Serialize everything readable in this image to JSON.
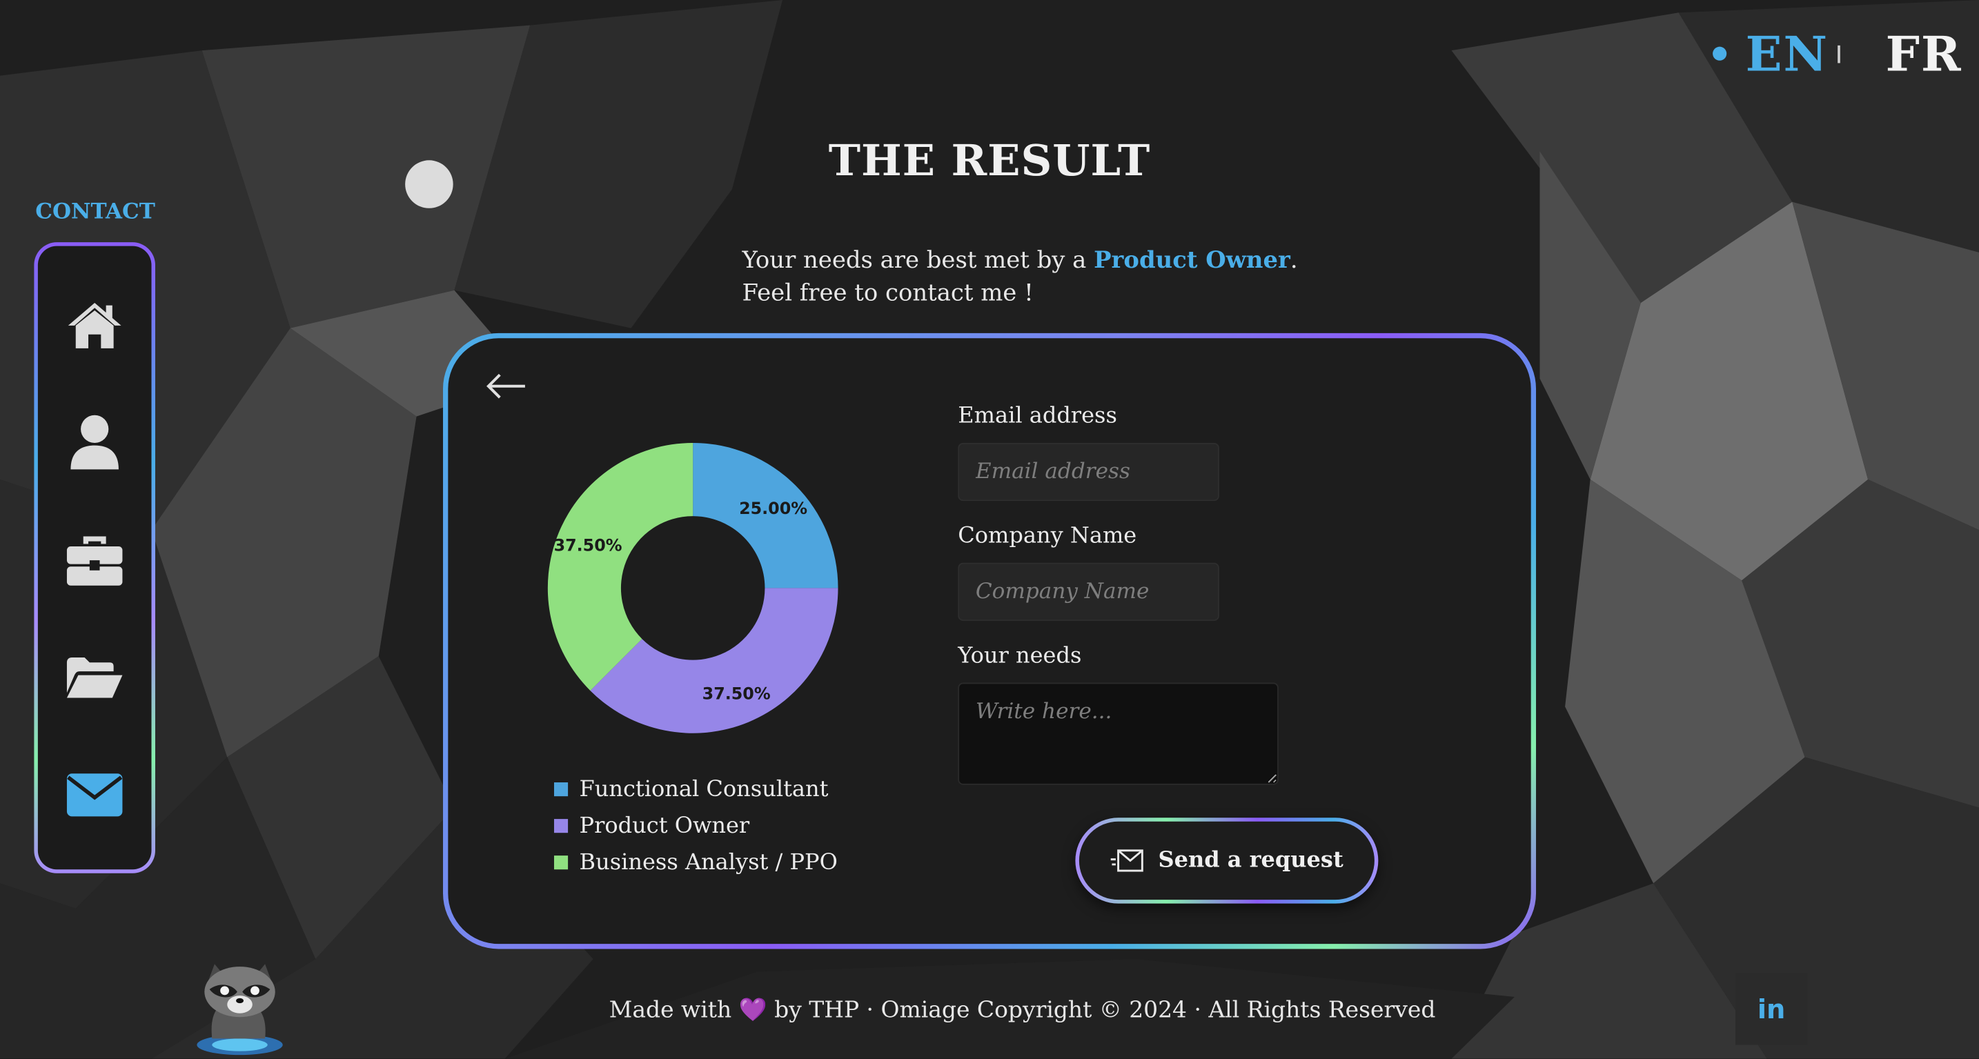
{
  "language_switch": {
    "en": "EN",
    "fr": "FR",
    "active": "EN"
  },
  "sidebar": {
    "title": "CONTACT",
    "items": [
      {
        "icon": "home-icon"
      },
      {
        "icon": "user-icon"
      },
      {
        "icon": "briefcase-icon"
      },
      {
        "icon": "folder-open-icon"
      },
      {
        "icon": "envelope-icon",
        "active": true
      }
    ]
  },
  "page": {
    "title": "THE RESULT",
    "intro_prefix": "Your needs are best met by a ",
    "intro_highlight": "Product Owner",
    "intro_suffix": ".",
    "intro_line2": "Feel free to contact me !"
  },
  "chart_data": {
    "type": "pie",
    "donut": true,
    "series": [
      {
        "name": "Functional Consultant",
        "value": 25.0,
        "color": "#4ea5de"
      },
      {
        "name": "Product Owner",
        "value": 37.5,
        "color": "#9686e8"
      },
      {
        "name": "Business Analyst / PPO",
        "value": 37.5,
        "color": "#90e080"
      }
    ],
    "data_labels": [
      "25.00%",
      "37.50%",
      "37.50%"
    ],
    "legend_position": "bottom"
  },
  "form": {
    "email_label": "Email address",
    "email_placeholder": "Email address",
    "company_label": "Company Name",
    "company_placeholder": "Company Name",
    "needs_label": "Your needs",
    "needs_placeholder": "Write here...",
    "send_label": "Send a request"
  },
  "footer": {
    "prefix": "Made with ",
    "heart": "💜",
    "suffix": " by THP · Omiage Copyright © 2024 · All Rights Reserved",
    "linkedin": "in"
  },
  "colors": {
    "accent": "#4aaee8",
    "purple": "#8b5cf6",
    "green": "#86efac"
  }
}
